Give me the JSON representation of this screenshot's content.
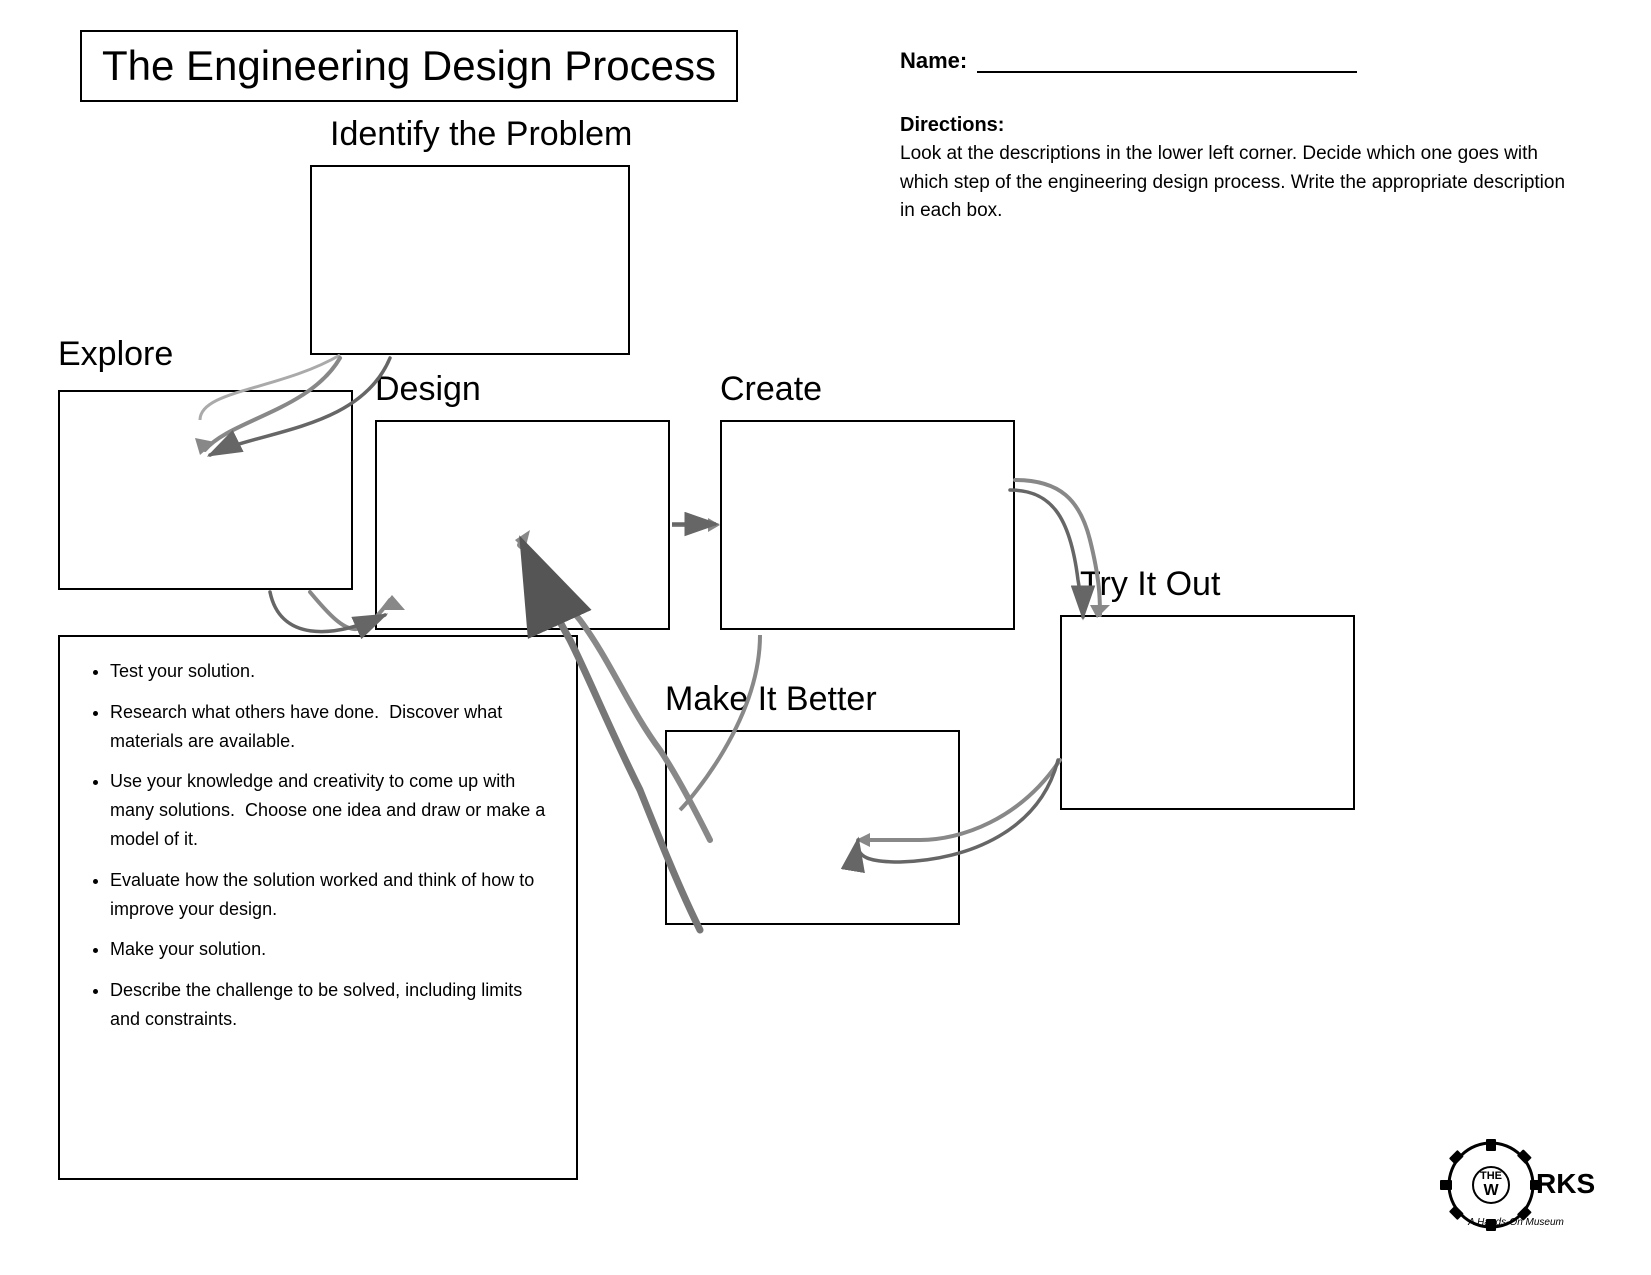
{
  "title": "The Engineering Design Process",
  "name_label": "Name:",
  "directions_title": "Directions:",
  "directions_text": "Look at the descriptions in the lower left corner. Decide which one goes with which step of the engineering design process.  Write the appropriate description in each box.",
  "steps": {
    "identify": "Identify the Problem",
    "explore": "Explore",
    "design": "Design",
    "create": "Create",
    "try_it_out": "Try It Out",
    "make_it_better": "Make It Better"
  },
  "descriptions": [
    "Test your solution.",
    "Research what others have done.  Discover what materials are available.",
    "Use your knowledge and creativity to come up with many solutions.  Choose one idea and draw or make a model of it.",
    "Evaluate how the solution worked and think of how to improve your design.",
    "Make your solution.",
    "Describe the challenge to be solved, including limits and constraints."
  ],
  "logo": {
    "top": "THE",
    "main": "W RKS",
    "subtitle": "A Hands-On Museum"
  }
}
